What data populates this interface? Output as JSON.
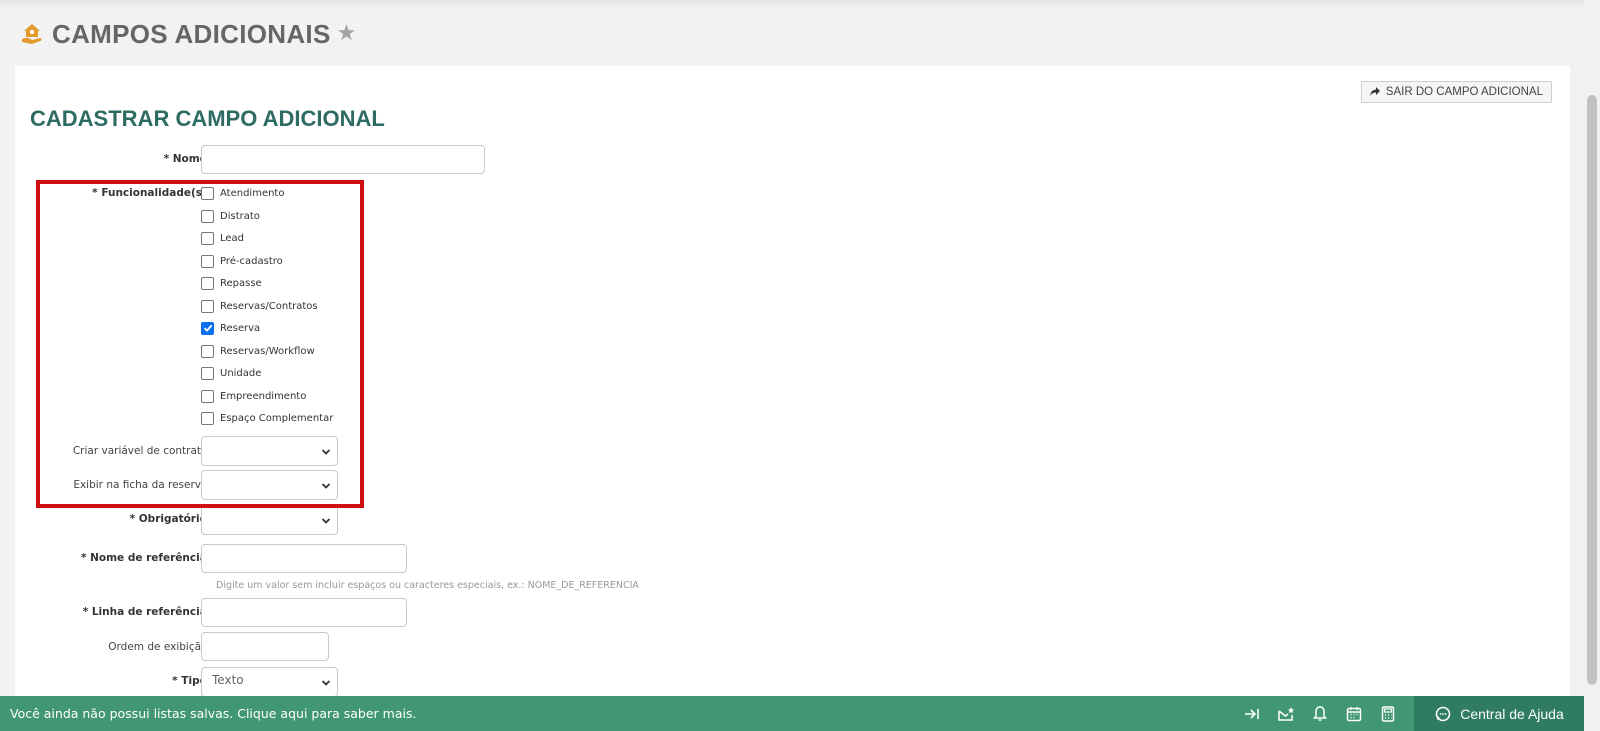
{
  "header": {
    "title": "CAMPOS ADICIONAIS",
    "logo_icon": "house-hand-icon",
    "favorite_icon": "star-icon"
  },
  "actions": {
    "exit_label": "SAIR DO CAMPO ADICIONAL"
  },
  "form": {
    "title": "CADASTRAR CAMPO ADICIONAL",
    "nome_label": "* Nome:",
    "func_label": "* Funcionalidade(s):",
    "checkboxes": [
      {
        "label": "Atendimento",
        "checked": false
      },
      {
        "label": "Distrato",
        "checked": false
      },
      {
        "label": "Lead",
        "checked": false
      },
      {
        "label": "Pré-cadastro",
        "checked": false
      },
      {
        "label": "Repasse",
        "checked": false
      },
      {
        "label": "Reservas/Contratos",
        "checked": false
      },
      {
        "label": "Reserva",
        "checked": true
      },
      {
        "label": "Reservas/Workflow",
        "checked": false
      },
      {
        "label": "Unidade",
        "checked": false
      },
      {
        "label": "Empreendimento",
        "checked": false
      },
      {
        "label": "Espaço Complementar",
        "checked": false
      }
    ],
    "criar_variavel_label": "Criar variável de contrato:",
    "exibir_ficha_label": "Exibir na ficha da reserva:",
    "obrigatorio_label": "* Obrigatório:",
    "nome_ref_label": "* Nome de referência:",
    "nome_ref_hint": "Digite um valor sem incluir espaços ou caracteres especiais, ex.: NOME_DE_REFERENCIA",
    "linha_ref_label": "* Linha de referência:",
    "ordem_label": "Ordem de exibição:",
    "tipo_label": "* Tipo:",
    "tipo_value": "Texto"
  },
  "footer": {
    "message": "Você ainda não possui listas salvas. Clique aqui para saber mais.",
    "icons": [
      "arrow-to-right-icon",
      "mail-star-icon",
      "bell-icon",
      "calendar-icon",
      "calculator-icon"
    ],
    "help_label": "Central de Ajuda"
  },
  "colors": {
    "title_teal": "#2d6b63",
    "footer_green": "#419773",
    "help_green": "#2f7c60",
    "highlight_red": "#d00f12",
    "checkbox_blue": "#0b6ff0"
  }
}
